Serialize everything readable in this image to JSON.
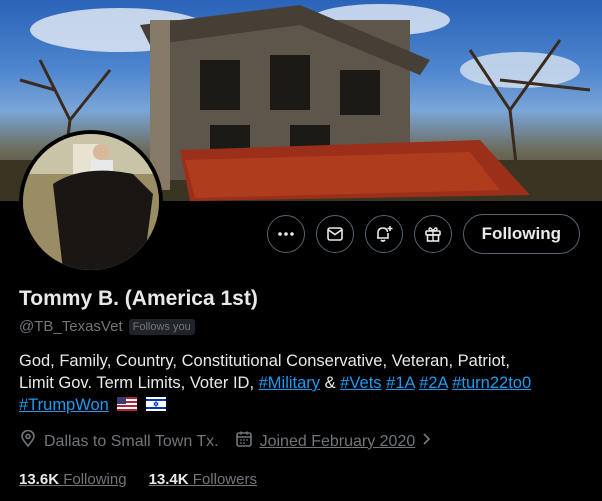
{
  "profile": {
    "display_name": "Tommy B. (America 1st)",
    "handle": "@TB_TexasVet",
    "follows_you_label": "Follows you",
    "bio": {
      "line1": "God, Family, Country, Constitutional Conservative, Veteran, Patriot,",
      "line2_prefix": "Limit Gov. Term Limits, Voter ID, ",
      "tag_military": "#Military",
      "amp": " & ",
      "tag_vets": "#Vets",
      "tag_1a": "#1A",
      "tag_2a": "#2A",
      "tag_turn": "#turn22to0",
      "tag_trumpwon": "#TrumpWon",
      "flags": [
        "us-flag-emoji",
        "israel-flag-emoji"
      ]
    },
    "location": "Dallas to Small Town Tx.",
    "joined": "Joined February 2020",
    "following_count": "13.6K",
    "following_label": "Following",
    "followers_count": "13.4K",
    "followers_label": "Followers"
  },
  "actions": {
    "more_icon": "more-icon",
    "message_icon": "message-icon",
    "notify_icon": "bell-plus-icon",
    "subscribe_icon": "gift-icon",
    "following_button": "Following"
  },
  "colors": {
    "background": "#000000",
    "link": "#1d9bf0",
    "muted": "#71767b",
    "text": "#e7e9ea"
  }
}
